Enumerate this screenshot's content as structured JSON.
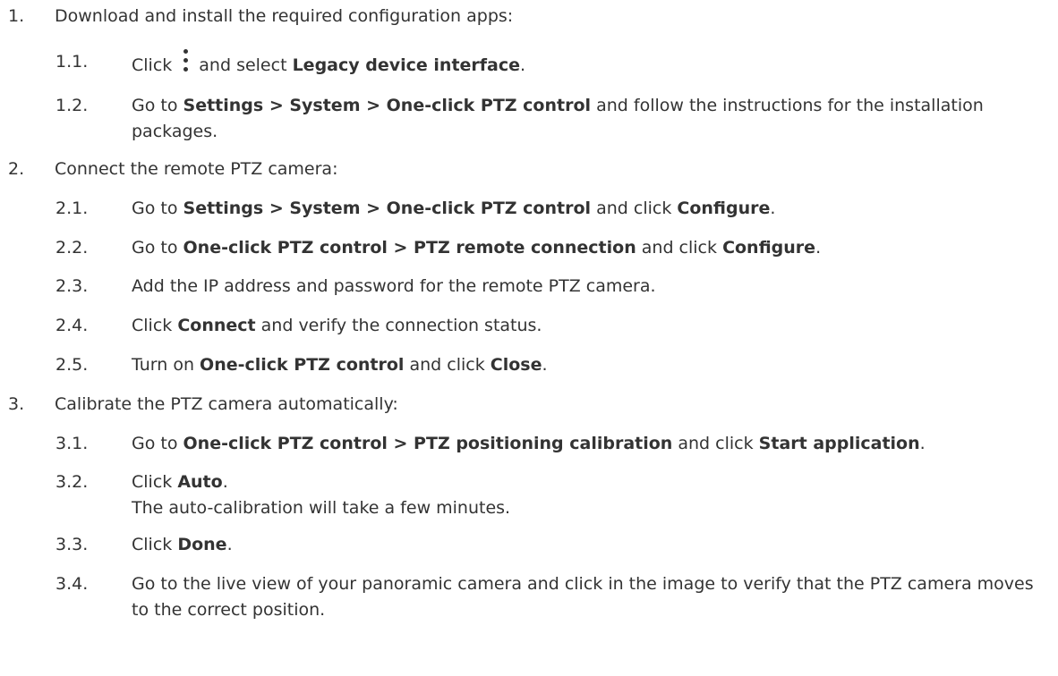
{
  "steps": [
    {
      "number": "1.",
      "text": "Download and install the required configuration apps:",
      "substeps": [
        {
          "number": "1.1.",
          "t0": "Click",
          "icon": "more-vertical-icon",
          "t1": "and select",
          "b1": "Legacy device interface",
          "t2": "."
        },
        {
          "number": "1.2.",
          "t0": "Go to",
          "b0": "Settings > System > One-click PTZ control",
          "t1": "and follow the instructions for the installation packages."
        }
      ]
    },
    {
      "number": "2.",
      "text": "Connect the remote PTZ camera:",
      "substeps": [
        {
          "number": "2.1.",
          "t0": "Go to",
          "b0": "Settings > System > One-click PTZ control",
          "t1": "and click",
          "b1": "Configure",
          "t2": "."
        },
        {
          "number": "2.2.",
          "t0": "Go to",
          "b0": "One-click PTZ control > PTZ remote connection",
          "t1": "and click",
          "b1": "Configure",
          "t2": "."
        },
        {
          "number": "2.3.",
          "t0": "Add the IP address and password for the remote PTZ camera."
        },
        {
          "number": "2.4.",
          "t0": "Click",
          "b0": "Connect",
          "t1": "and verify the connection status."
        },
        {
          "number": "2.5.",
          "t0": "Turn on",
          "b0": "One-click PTZ control",
          "t1": "and click",
          "b1": "Close",
          "t2": "."
        }
      ]
    },
    {
      "number": "3.",
      "text": "Calibrate the PTZ camera automatically:",
      "substeps": [
        {
          "number": "3.1.",
          "t0": "Go to",
          "b0": "One-click PTZ control > PTZ positioning calibration",
          "t1": "and click",
          "b1": "Start application",
          "t2": "."
        },
        {
          "number": "3.2.",
          "t0": "Click",
          "b0": "Auto",
          "t1": ".",
          "line2": "The auto-calibration will take a few minutes."
        },
        {
          "number": "3.3.",
          "t0": "Click",
          "b0": "Done",
          "t1": "."
        },
        {
          "number": "3.4.",
          "t0": "Go to the live view of your panoramic camera and click in the image to verify that the PTZ camera moves to the correct position."
        }
      ]
    }
  ]
}
